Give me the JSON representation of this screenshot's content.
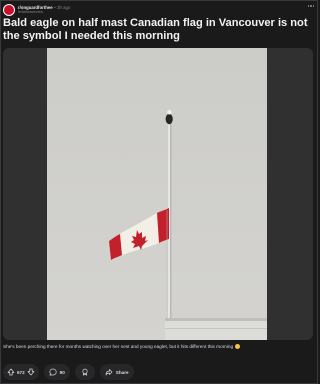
{
  "post": {
    "subreddit": "r/onguardforthee",
    "separator": "•",
    "time": "3h ago",
    "author": "fellatheatreview",
    "title": "Bald eagle on half mast Canadian flag in Vancouver is not the symbol I needed this morning",
    "caption": "She's been perching there for months watching over her nest and young eaglet, but it hits different this morning",
    "brand_color": "#c8102e"
  },
  "actions": {
    "upvotes": "672",
    "comments": "90",
    "share_label": "Share"
  },
  "icons": {
    "subreddit": "subreddit-avatar-icon",
    "more": "more-options-icon",
    "upvote": "upvote-arrow-icon",
    "downvote": "downvote-arrow-icon",
    "comment": "comment-bubble-icon",
    "award": "award-icon",
    "share": "share-arrow-icon",
    "emoji": "sad-face-emoji-icon"
  }
}
